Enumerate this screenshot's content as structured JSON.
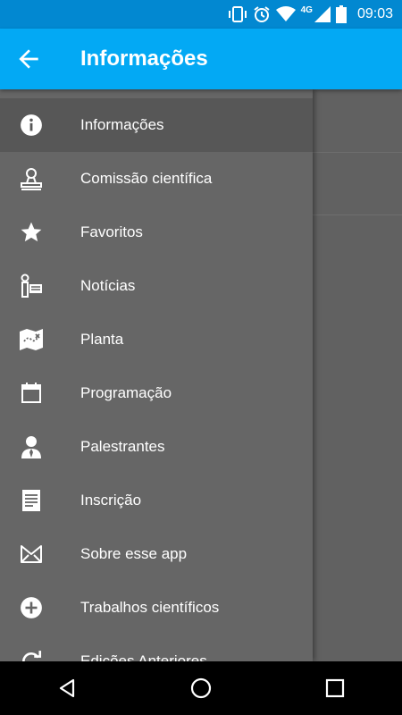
{
  "status": {
    "time": "09:03",
    "network": "4G"
  },
  "appbar": {
    "title": "Informações"
  },
  "drawer": {
    "items": [
      {
        "label": "Informações",
        "icon": "info-icon"
      },
      {
        "label": "Comissão científica",
        "icon": "stamp-icon"
      },
      {
        "label": "Favoritos",
        "icon": "star-icon"
      },
      {
        "label": "Notícias",
        "icon": "reporter-icon"
      },
      {
        "label": "Planta",
        "icon": "map-icon"
      },
      {
        "label": "Programação",
        "icon": "calendar-icon"
      },
      {
        "label": "Palestrantes",
        "icon": "speaker-icon"
      },
      {
        "label": "Inscrição",
        "icon": "document-icon"
      },
      {
        "label": "Sobre esse app",
        "icon": "envelope-icon"
      },
      {
        "label": "Trabalhos científicos",
        "icon": "add-circle-icon"
      },
      {
        "label": "Edições Anteriores",
        "icon": "refresh-icon"
      }
    ]
  },
  "colors": {
    "statusbar": "#0288d1",
    "appbar": "#03a9f4",
    "drawer": "#666666"
  }
}
